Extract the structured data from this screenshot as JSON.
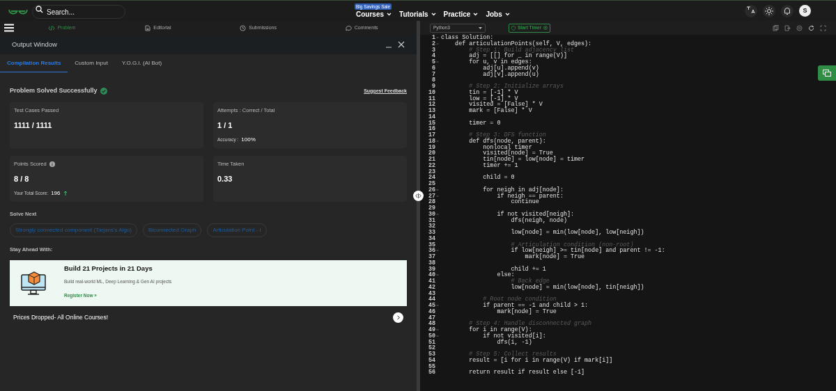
{
  "navbar": {
    "search": {
      "placeholder": "Search..."
    },
    "menu": [
      {
        "label": "Courses",
        "badge": "Big Savings Sale"
      },
      {
        "label": "Tutorials"
      },
      {
        "label": "Practice"
      },
      {
        "label": "Jobs"
      }
    ],
    "avatar": "S"
  },
  "problem_tabs": [
    {
      "label": "Problem",
      "selected": true
    },
    {
      "label": "Editorial",
      "selected": false
    },
    {
      "label": "Submissions",
      "selected": false
    },
    {
      "label": "Comments",
      "selected": false
    }
  ],
  "output_window": {
    "title": "Output Window",
    "tabs": [
      {
        "label": "Compilation Results",
        "selected": true
      },
      {
        "label": "Custom Input",
        "selected": false
      },
      {
        "label": "Y.O.G.I. (AI Bot)",
        "selected": false
      }
    ],
    "status": "Problem Solved Successfully",
    "feedback_link": "Suggest Feedback",
    "stats": [
      {
        "label": "Test Cases Passed",
        "info": false,
        "value": "1111 / 1111"
      },
      {
        "label": "Attempts : Correct / Total",
        "info": false,
        "value": "1 / 1",
        "sub_label": "Accuracy :",
        "sub_value": "100%",
        "rising": false
      },
      {
        "label": "Points Scored",
        "info": true,
        "value": "8 / 8",
        "sub_label": "Your Total Score:",
        "sub_value": "196",
        "rising": true
      },
      {
        "label": "Time Taken",
        "info": false,
        "value": "0.33"
      }
    ],
    "solve_next": {
      "heading": "Solve Next",
      "items": [
        "Strongly connected component (Tarjans's Algo)",
        "Biconnected Graph",
        "Articulation Point - I"
      ]
    },
    "stay_ahead": {
      "heading": "Stay Ahead With:",
      "promo": {
        "title": "Build 21 Projects in 21 Days",
        "text": "Build real-world ML, Deep Learning & Gen AI projects",
        "link": "Register Now »"
      }
    },
    "ticker": "Prices Dropped- All Online Courses!"
  },
  "editor": {
    "language": "Python3",
    "timer_button": "Start Timer",
    "lines": [
      {
        "n": "1",
        "kind": "code",
        "fold": true,
        "text": "class Solution:"
      },
      {
        "n": "2",
        "kind": "code",
        "fold": true,
        "text": "    def articulationPoints(self, V, edges):"
      },
      {
        "n": "3",
        "kind": "comment",
        "fold": false,
        "text": "        # Step 1: Build adjacency list"
      },
      {
        "n": "4",
        "kind": "code",
        "fold": false,
        "text": "        adj = [[] for _ in range(V)]"
      },
      {
        "n": "5",
        "kind": "code",
        "fold": true,
        "text": "        for u, v in edges:"
      },
      {
        "n": "6",
        "kind": "code",
        "fold": false,
        "text": "            adj[u].append(v)"
      },
      {
        "n": "7",
        "kind": "code",
        "fold": false,
        "text": "            adj[v].append(u)"
      },
      {
        "n": "8",
        "kind": "blank",
        "fold": false
      },
      {
        "n": "9",
        "kind": "comment",
        "fold": false,
        "text": "        # Step 2: Initialize arrays"
      },
      {
        "n": "10",
        "kind": "code",
        "fold": false,
        "text": "        tin = [-1] * V"
      },
      {
        "n": "11",
        "kind": "code",
        "fold": false,
        "text": "        low = [-1] * V"
      },
      {
        "n": "12",
        "kind": "code",
        "fold": false,
        "text": "        visited = [False] * V"
      },
      {
        "n": "13",
        "kind": "code",
        "fold": false,
        "text": "        mark = [False] * V"
      },
      {
        "n": "14",
        "kind": "blank",
        "fold": false
      },
      {
        "n": "15",
        "kind": "code",
        "fold": false,
        "text": "        timer = 0"
      },
      {
        "n": "16",
        "kind": "blank",
        "fold": false
      },
      {
        "n": "17",
        "kind": "comment",
        "fold": false,
        "text": "        # Step 3: DFS function"
      },
      {
        "n": "18",
        "kind": "code",
        "fold": true,
        "text": "        def dfs(node, parent):"
      },
      {
        "n": "19",
        "kind": "code",
        "fold": false,
        "text": "            nonlocal timer"
      },
      {
        "n": "20",
        "kind": "code",
        "fold": false,
        "text": "            visited[node] = True"
      },
      {
        "n": "21",
        "kind": "code",
        "fold": false,
        "text": "            tin[node] = low[node] = timer"
      },
      {
        "n": "22",
        "kind": "code",
        "fold": false,
        "text": "            timer += 1"
      },
      {
        "n": "23",
        "kind": "blank",
        "fold": false
      },
      {
        "n": "24",
        "kind": "code",
        "fold": false,
        "text": "            child = 0"
      },
      {
        "n": "25",
        "kind": "blank",
        "fold": false
      },
      {
        "n": "26",
        "kind": "code",
        "fold": true,
        "text": "            for neigh in adj[node]:"
      },
      {
        "n": "27",
        "kind": "code",
        "fold": true,
        "text": "                if neigh == parent:"
      },
      {
        "n": "28",
        "kind": "code",
        "fold": false,
        "text": "                    continue"
      },
      {
        "n": "29",
        "kind": "blank",
        "fold": false
      },
      {
        "n": "30",
        "kind": "code",
        "fold": true,
        "text": "                if not visited[neigh]:"
      },
      {
        "n": "31",
        "kind": "code",
        "fold": false,
        "text": "                    dfs(neigh, node)"
      },
      {
        "n": "32",
        "kind": "blank",
        "fold": false
      },
      {
        "n": "33",
        "kind": "code",
        "fold": false,
        "text": "                    low[node] = min(low[node], low[neigh])"
      },
      {
        "n": "34",
        "kind": "blank",
        "fold": false
      },
      {
        "n": "35",
        "kind": "comment",
        "fold": false,
        "text": "                    # Articulation condition (non-root)"
      },
      {
        "n": "36",
        "kind": "code",
        "fold": true,
        "text": "                    if low[neigh] >= tin[node] and parent != -1:"
      },
      {
        "n": "37",
        "kind": "code",
        "fold": false,
        "text": "                        mark[node] = True"
      },
      {
        "n": "38",
        "kind": "blank",
        "fold": false
      },
      {
        "n": "39",
        "kind": "code",
        "fold": false,
        "text": "                    child += 1"
      },
      {
        "n": "40",
        "kind": "code",
        "fold": true,
        "text": "                else:"
      },
      {
        "n": "41",
        "kind": "comment",
        "fold": false,
        "text": "                    # Back edge"
      },
      {
        "n": "42",
        "kind": "code",
        "fold": false,
        "text": "                    low[node] = min(low[node], tin[neigh])"
      },
      {
        "n": "43",
        "kind": "blank",
        "fold": false
      },
      {
        "n": "44",
        "kind": "comment",
        "fold": false,
        "text": "            # Root node condition"
      },
      {
        "n": "45",
        "kind": "code",
        "fold": true,
        "text": "            if parent == -1 and child > 1:"
      },
      {
        "n": "46",
        "kind": "code",
        "fold": false,
        "text": "                mark[node] = True"
      },
      {
        "n": "47",
        "kind": "blank",
        "fold": false
      },
      {
        "n": "48",
        "kind": "comment",
        "fold": false,
        "text": "        # Step 4: Handle disconnected graph"
      },
      {
        "n": "49",
        "kind": "code",
        "fold": true,
        "text": "        for i in range(V):"
      },
      {
        "n": "50",
        "kind": "code",
        "fold": true,
        "text": "            if not visited[i]:"
      },
      {
        "n": "51",
        "kind": "code",
        "fold": false,
        "text": "                dfs(i, -1)"
      },
      {
        "n": "52",
        "kind": "blank",
        "fold": false
      },
      {
        "n": "53",
        "kind": "comment",
        "fold": false,
        "text": "        # Step 5: Collect results"
      },
      {
        "n": "54",
        "kind": "code",
        "fold": false,
        "text": "        result = [i for i in range(V) if mark[i]]"
      },
      {
        "n": "55",
        "kind": "blank",
        "fold": false
      },
      {
        "n": "56",
        "kind": "code",
        "fold": false,
        "text": "        return result if result else [-1]"
      }
    ]
  }
}
